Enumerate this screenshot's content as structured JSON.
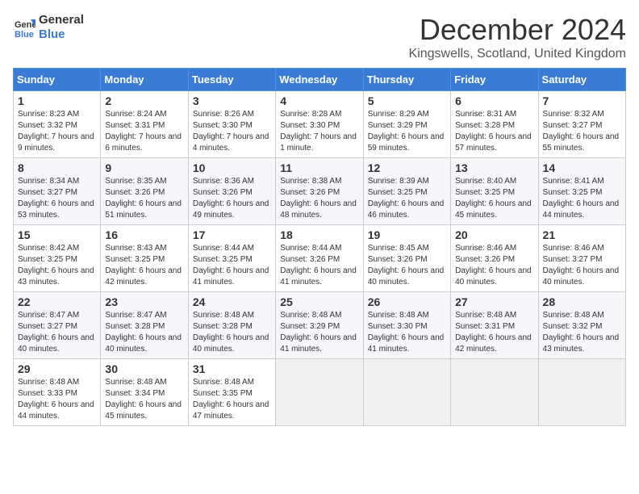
{
  "header": {
    "logo_line1": "General",
    "logo_line2": "Blue",
    "month": "December 2024",
    "location": "Kingswells, Scotland, United Kingdom"
  },
  "days_of_week": [
    "Sunday",
    "Monday",
    "Tuesday",
    "Wednesday",
    "Thursday",
    "Friday",
    "Saturday"
  ],
  "weeks": [
    [
      {
        "day": "1",
        "sunrise": "8:23 AM",
        "sunset": "3:32 PM",
        "daylight": "7 hours and 9 minutes."
      },
      {
        "day": "2",
        "sunrise": "8:24 AM",
        "sunset": "3:31 PM",
        "daylight": "7 hours and 6 minutes."
      },
      {
        "day": "3",
        "sunrise": "8:26 AM",
        "sunset": "3:30 PM",
        "daylight": "7 hours and 4 minutes."
      },
      {
        "day": "4",
        "sunrise": "8:28 AM",
        "sunset": "3:30 PM",
        "daylight": "7 hours and 1 minute."
      },
      {
        "day": "5",
        "sunrise": "8:29 AM",
        "sunset": "3:29 PM",
        "daylight": "6 hours and 59 minutes."
      },
      {
        "day": "6",
        "sunrise": "8:31 AM",
        "sunset": "3:28 PM",
        "daylight": "6 hours and 57 minutes."
      },
      {
        "day": "7",
        "sunrise": "8:32 AM",
        "sunset": "3:27 PM",
        "daylight": "6 hours and 55 minutes."
      }
    ],
    [
      {
        "day": "8",
        "sunrise": "8:34 AM",
        "sunset": "3:27 PM",
        "daylight": "6 hours and 53 minutes."
      },
      {
        "day": "9",
        "sunrise": "8:35 AM",
        "sunset": "3:26 PM",
        "daylight": "6 hours and 51 minutes."
      },
      {
        "day": "10",
        "sunrise": "8:36 AM",
        "sunset": "3:26 PM",
        "daylight": "6 hours and 49 minutes."
      },
      {
        "day": "11",
        "sunrise": "8:38 AM",
        "sunset": "3:26 PM",
        "daylight": "6 hours and 48 minutes."
      },
      {
        "day": "12",
        "sunrise": "8:39 AM",
        "sunset": "3:25 PM",
        "daylight": "6 hours and 46 minutes."
      },
      {
        "day": "13",
        "sunrise": "8:40 AM",
        "sunset": "3:25 PM",
        "daylight": "6 hours and 45 minutes."
      },
      {
        "day": "14",
        "sunrise": "8:41 AM",
        "sunset": "3:25 PM",
        "daylight": "6 hours and 44 minutes."
      }
    ],
    [
      {
        "day": "15",
        "sunrise": "8:42 AM",
        "sunset": "3:25 PM",
        "daylight": "6 hours and 43 minutes."
      },
      {
        "day": "16",
        "sunrise": "8:43 AM",
        "sunset": "3:25 PM",
        "daylight": "6 hours and 42 minutes."
      },
      {
        "day": "17",
        "sunrise": "8:44 AM",
        "sunset": "3:25 PM",
        "daylight": "6 hours and 41 minutes."
      },
      {
        "day": "18",
        "sunrise": "8:44 AM",
        "sunset": "3:26 PM",
        "daylight": "6 hours and 41 minutes."
      },
      {
        "day": "19",
        "sunrise": "8:45 AM",
        "sunset": "3:26 PM",
        "daylight": "6 hours and 40 minutes."
      },
      {
        "day": "20",
        "sunrise": "8:46 AM",
        "sunset": "3:26 PM",
        "daylight": "6 hours and 40 minutes."
      },
      {
        "day": "21",
        "sunrise": "8:46 AM",
        "sunset": "3:27 PM",
        "daylight": "6 hours and 40 minutes."
      }
    ],
    [
      {
        "day": "22",
        "sunrise": "8:47 AM",
        "sunset": "3:27 PM",
        "daylight": "6 hours and 40 minutes."
      },
      {
        "day": "23",
        "sunrise": "8:47 AM",
        "sunset": "3:28 PM",
        "daylight": "6 hours and 40 minutes."
      },
      {
        "day": "24",
        "sunrise": "8:48 AM",
        "sunset": "3:28 PM",
        "daylight": "6 hours and 40 minutes."
      },
      {
        "day": "25",
        "sunrise": "8:48 AM",
        "sunset": "3:29 PM",
        "daylight": "6 hours and 41 minutes."
      },
      {
        "day": "26",
        "sunrise": "8:48 AM",
        "sunset": "3:30 PM",
        "daylight": "6 hours and 41 minutes."
      },
      {
        "day": "27",
        "sunrise": "8:48 AM",
        "sunset": "3:31 PM",
        "daylight": "6 hours and 42 minutes."
      },
      {
        "day": "28",
        "sunrise": "8:48 AM",
        "sunset": "3:32 PM",
        "daylight": "6 hours and 43 minutes."
      }
    ],
    [
      {
        "day": "29",
        "sunrise": "8:48 AM",
        "sunset": "3:33 PM",
        "daylight": "6 hours and 44 minutes."
      },
      {
        "day": "30",
        "sunrise": "8:48 AM",
        "sunset": "3:34 PM",
        "daylight": "6 hours and 45 minutes."
      },
      {
        "day": "31",
        "sunrise": "8:48 AM",
        "sunset": "3:35 PM",
        "daylight": "6 hours and 47 minutes."
      },
      null,
      null,
      null,
      null
    ]
  ],
  "labels": {
    "sunrise": "Sunrise:",
    "sunset": "Sunset:",
    "daylight": "Daylight:"
  }
}
